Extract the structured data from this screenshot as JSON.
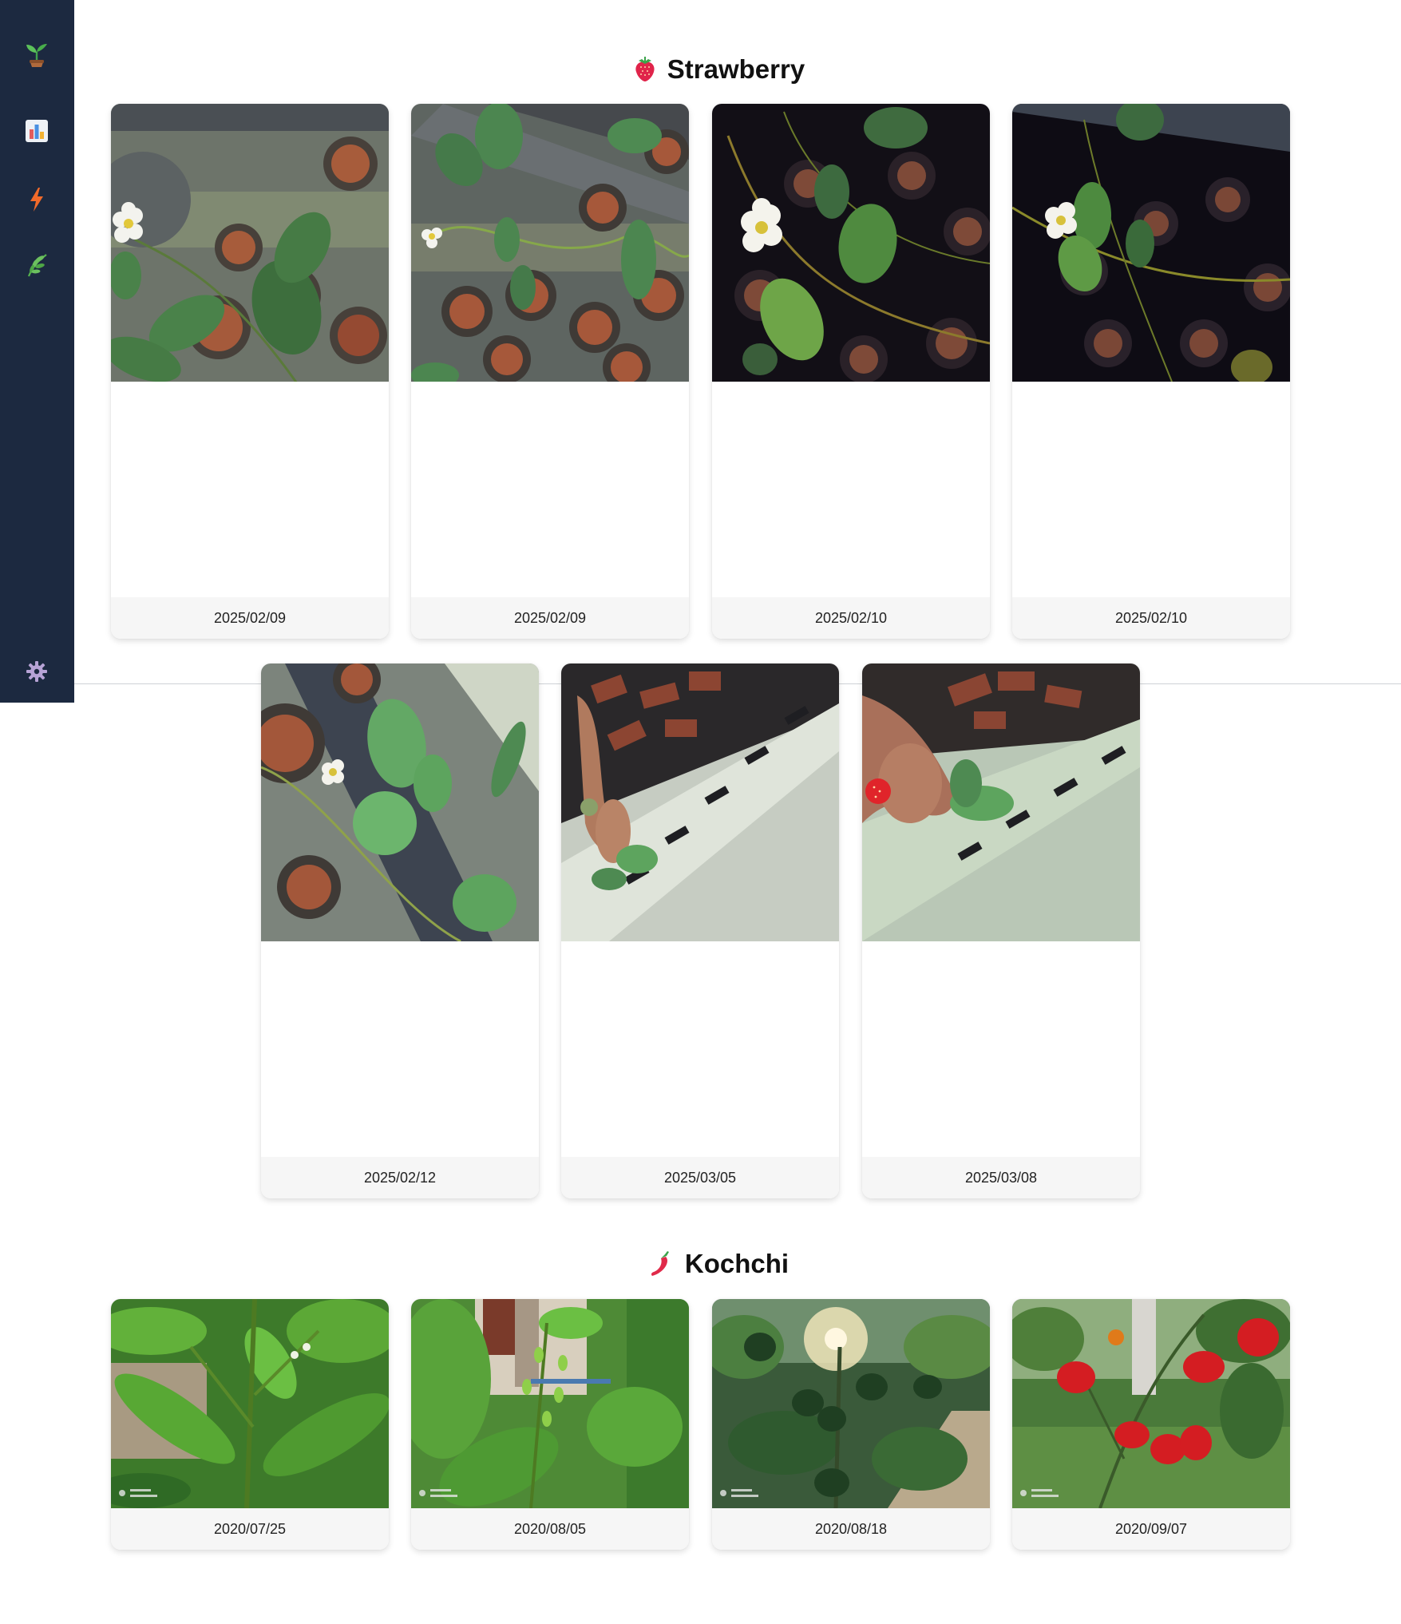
{
  "sidebar": {
    "items": [
      {
        "name": "seedling",
        "icon": "seedling-icon"
      },
      {
        "name": "dashboard",
        "icon": "chart-icon"
      },
      {
        "name": "activity",
        "icon": "lightning-icon"
      },
      {
        "name": "plants",
        "icon": "herb-icon"
      }
    ],
    "settings_icon": "gear-icon"
  },
  "sections": [
    {
      "title": "Strawberry",
      "icon": "strawberry-icon",
      "photos": [
        {
          "date": "2025/02/09"
        },
        {
          "date": "2025/02/09"
        },
        {
          "date": "2025/02/10"
        },
        {
          "date": "2025/02/10"
        },
        {
          "date": "2025/02/12"
        },
        {
          "date": "2025/03/05"
        },
        {
          "date": "2025/03/08"
        }
      ]
    },
    {
      "title": "Kochchi",
      "icon": "chili-pepper-icon",
      "photos": [
        {
          "date": "2020/07/25"
        },
        {
          "date": "2020/08/05"
        },
        {
          "date": "2020/08/18"
        },
        {
          "date": "2020/09/07"
        }
      ]
    }
  ],
  "colors": {
    "sidebar_bg": "#1c2940",
    "page_bg": "#ffffff",
    "date_bar_bg": "#f6f6f6"
  }
}
